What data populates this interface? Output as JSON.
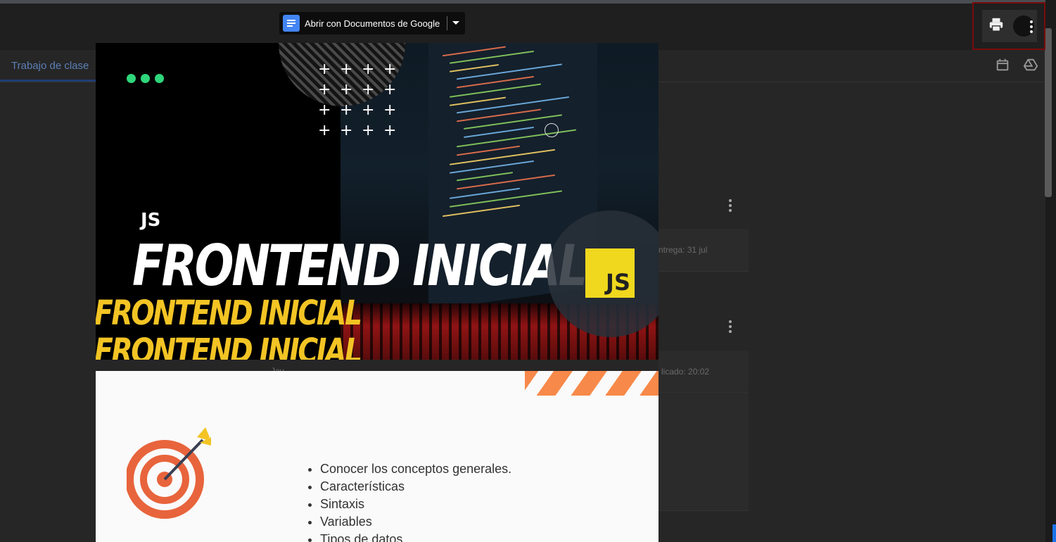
{
  "toolbar": {
    "open_with_label": "Abrir con Documentos de Google"
  },
  "tabs": {
    "active_label": "Trabajo de clase"
  },
  "background": {
    "due_text": "ntrega: 31 jul",
    "posted_text": "licado: 20:02",
    "author_text": "Jav..."
  },
  "slide1": {
    "js_label": "JS",
    "title": "FRONTEND INICIAL",
    "repeat_title": "FRONTEND INICIAL",
    "badge_text": "JS"
  },
  "slide2": {
    "bullets": [
      "Conocer los conceptos generales.",
      "Características",
      "Sintaxis",
      "Variables",
      "Tipos de datos"
    ]
  },
  "colors": {
    "accent_green": "#2fd67b",
    "js_yellow": "#efd81d",
    "stripe_orange": "#f7894a",
    "target_red": "#e8643c",
    "docs_blue": "#4285f4"
  },
  "icons": [
    "docs-icon",
    "dropdown-caret-icon",
    "print-icon",
    "more-vert-icon",
    "calendar-icon",
    "drive-icon",
    "target-icon"
  ]
}
